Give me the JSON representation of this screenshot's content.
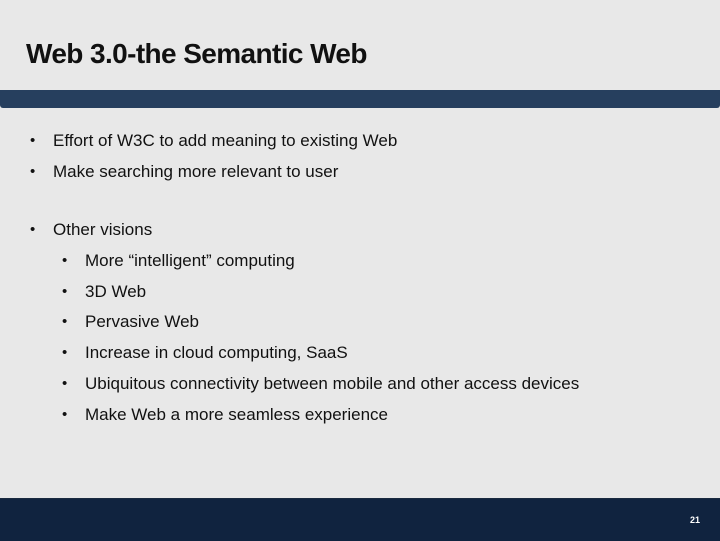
{
  "slide": {
    "title": "Web 3.0-the Semantic Web",
    "page_number": "21",
    "colors": {
      "background": "#e8e8e8",
      "header_band": "#263f5e",
      "footer_band": "#10233f",
      "text": "#111111"
    }
  },
  "bullets": {
    "bullet_glyph": "•",
    "level1": [
      "Effort of W3C to add meaning to existing Web",
      "Make searching more relevant to user",
      "Other visions"
    ],
    "other_visions": [
      "More “intelligent” computing",
      "3D Web",
      "Pervasive Web",
      "Increase in cloud computing, SaaS",
      "Ubiquitous connectivity between mobile and other access devices",
      "Make Web a more seamless experience"
    ]
  }
}
